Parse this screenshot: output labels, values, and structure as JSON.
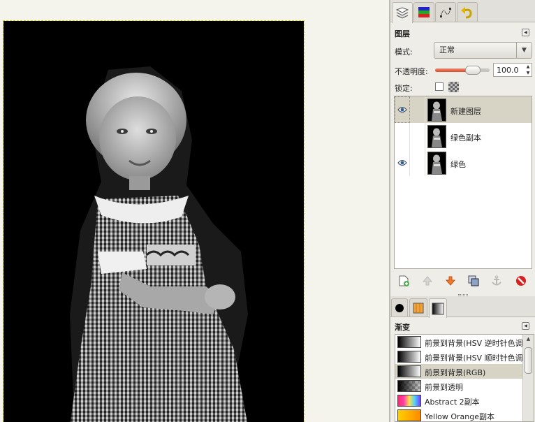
{
  "dock_tabs_top": [
    {
      "icon": "layers-icon",
      "label": "图层",
      "active": true
    },
    {
      "icon": "channels-icon",
      "label": "通道",
      "active": false
    },
    {
      "icon": "paths-icon",
      "label": "路径",
      "active": false
    },
    {
      "icon": "undo-history-icon",
      "label": "撤销历史",
      "active": false
    }
  ],
  "layers_panel": {
    "title": "图层",
    "mode_label": "模式:",
    "mode_value": "正常",
    "opacity_label": "不透明度:",
    "opacity_value": "100.0",
    "opacity_fraction": 0.8,
    "lock_label": "锁定:",
    "layers": [
      {
        "name": "新建图层",
        "visible": true,
        "selected": true
      },
      {
        "name": "绿色副本",
        "visible": false,
        "selected": false
      },
      {
        "name": "绿色",
        "visible": true,
        "selected": false
      }
    ],
    "buttons": [
      {
        "icon": "new-layer-icon",
        "enabled": true
      },
      {
        "icon": "raise-layer-icon",
        "enabled": false
      },
      {
        "icon": "lower-layer-icon",
        "enabled": true
      },
      {
        "icon": "duplicate-layer-icon",
        "enabled": true
      },
      {
        "icon": "anchor-layer-icon",
        "enabled": false
      },
      {
        "icon": "delete-layer-icon",
        "enabled": true
      }
    ]
  },
  "dock_tabs_bottom": [
    {
      "icon": "brushes-icon",
      "active": false
    },
    {
      "icon": "patterns-icon",
      "active": false
    },
    {
      "icon": "gradients-icon",
      "active": true
    }
  ],
  "gradients_panel": {
    "title": "渐变",
    "items": [
      {
        "name": "前景到背景(HSV 逆时针色调)",
        "selected": false
      },
      {
        "name": "前景到背景(HSV 顺时针色调)",
        "selected": false
      },
      {
        "name": "前景到背景(RGB)",
        "selected": true
      },
      {
        "name": "前景到透明",
        "selected": false
      },
      {
        "name": "Abstract 2副本",
        "selected": false
      },
      {
        "name": "Yellow Orange副本",
        "selected": false
      }
    ]
  },
  "colors": {
    "selection_row": "#d7d4c6",
    "opacity_fill": "#e0603f",
    "layer_boundary": "#e0d800"
  }
}
